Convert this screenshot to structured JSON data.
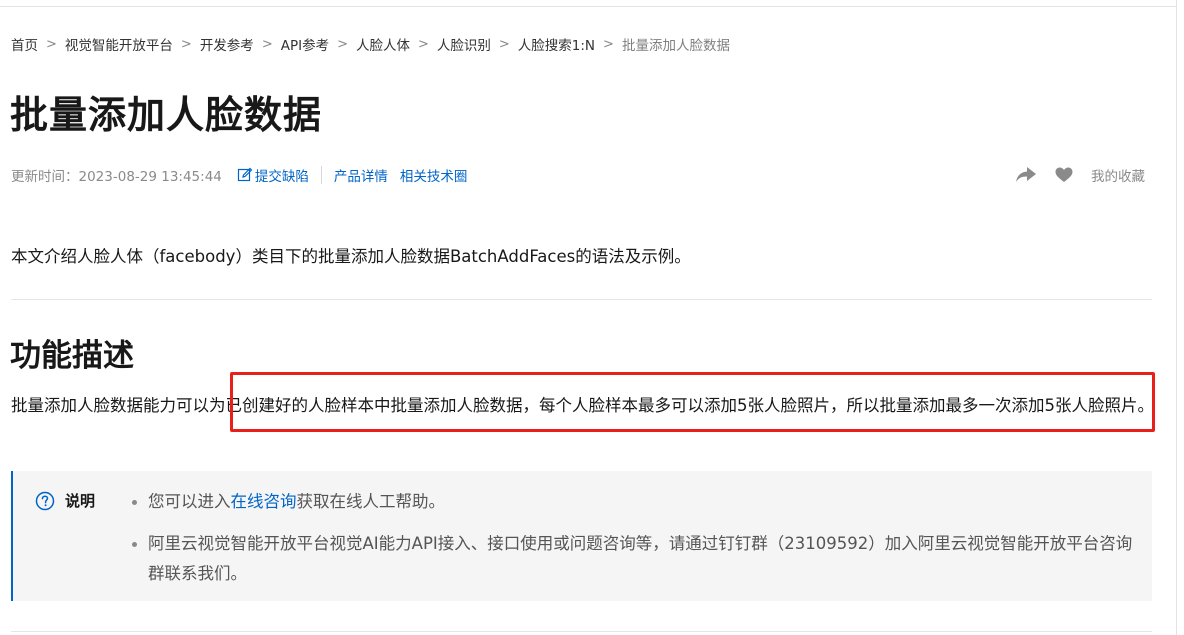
{
  "breadcrumb": {
    "items": [
      "首页",
      "视觉智能开放平台",
      "开发参考",
      "API参考",
      "人脸人体",
      "人脸识别",
      "人脸搜索1:N",
      "批量添加人脸数据"
    ],
    "separator": ">"
  },
  "page": {
    "title": "批量添加人脸数据"
  },
  "meta": {
    "updated_label": "更新时间：2023-08-29 13:45:44",
    "submit_bug": "提交缺陷",
    "product_details": "产品详情",
    "tech_circle": "相关技术圈"
  },
  "actions": {
    "favorites": "我的收藏",
    "share_icon": "share-icon",
    "heart_icon": "heart-icon"
  },
  "content": {
    "intro": "本文介绍人脸人体（facebody）类目下的批量添加人脸数据BatchAddFaces的语法及示例。",
    "section_title": "功能描述",
    "description": "批量添加人脸数据能力可以为已创建好的人脸样本中批量添加人脸数据，每个人脸样本最多可以添加5张人脸照片，所以批量添加最多一次添加5张人脸照片。"
  },
  "note": {
    "label": "说明",
    "item1_prefix": "您可以进入",
    "item1_link": "在线咨询",
    "item1_suffix": "获取在线人工帮助。",
    "item2": "阿里云视觉智能开放平台视觉AI能力API接入、接口使用或问题咨询等，请通过钉钉群（23109592）加入阿里云视觉智能开放平台咨询群联系我们。"
  },
  "colors": {
    "link": "#0064c8",
    "highlight": "#e8201a",
    "note_bg": "#f5f5f5"
  }
}
